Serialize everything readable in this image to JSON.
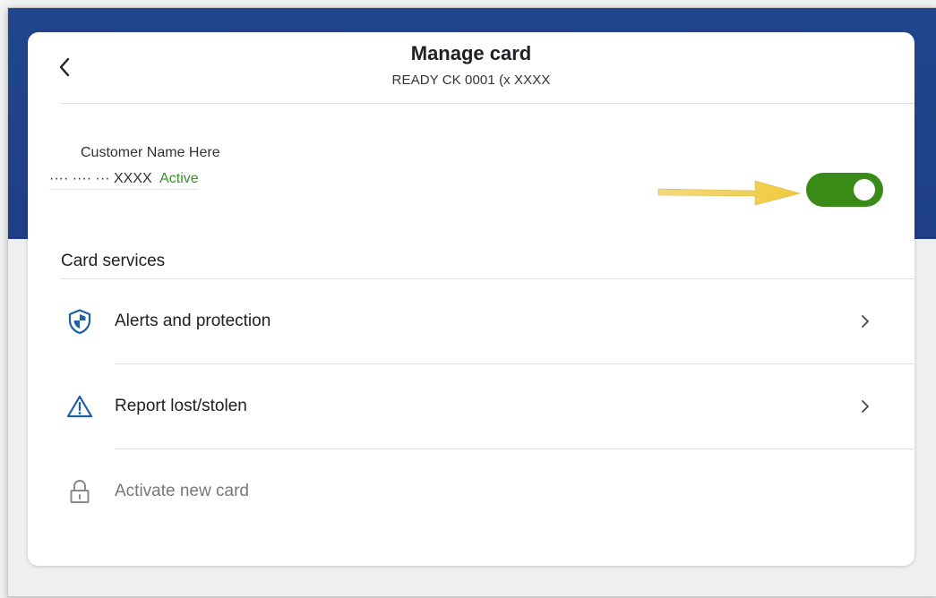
{
  "header": {
    "title": "Manage card",
    "subtitle": "READY CK 0001 (x XXXX"
  },
  "card_info": {
    "customer_name": "Customer Name Here",
    "masked_number": "···· ···· ··· XXXX",
    "status": "Active",
    "toggle_on": true
  },
  "card_services": {
    "title": "Card services",
    "items": [
      {
        "label": "Alerts and protection",
        "icon": "shield-icon",
        "enabled": true
      },
      {
        "label": "Report lost/stolen",
        "icon": "warning-triangle-icon",
        "enabled": true
      },
      {
        "label": "Activate new card",
        "icon": "lock-icon",
        "enabled": false
      }
    ]
  },
  "colors": {
    "band": "#21468f",
    "toggle_on": "#3a8a17",
    "active_text": "#3a8f2a",
    "icon_blue": "#1f5fa8",
    "annotation_arrow": "#f2d060"
  }
}
